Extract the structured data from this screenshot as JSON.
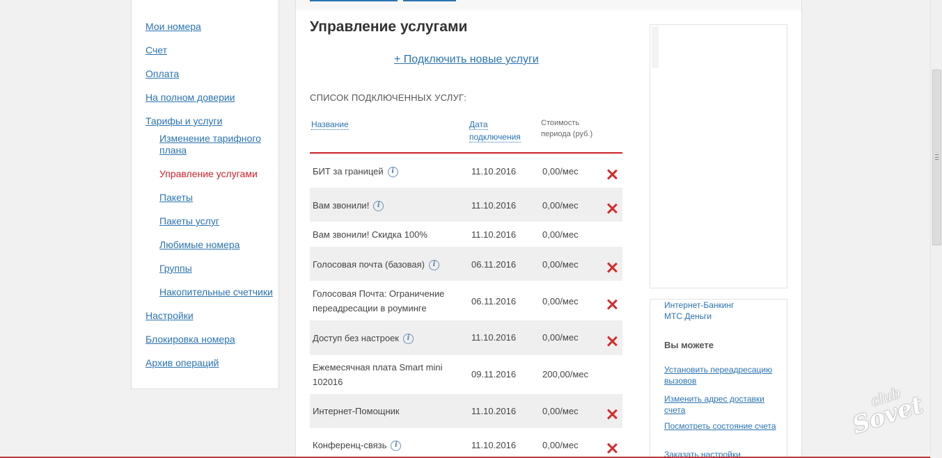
{
  "sidebar": {
    "items": [
      {
        "label": "Мои номера"
      },
      {
        "label": "Счет"
      },
      {
        "label": "Оплата"
      },
      {
        "label": "На полном доверии"
      },
      {
        "label": "Тарифы и услуги"
      },
      {
        "label": "Изменение тарифного плана"
      },
      {
        "label": "Управление услугами"
      },
      {
        "label": "Пакеты"
      },
      {
        "label": "Пакеты услуг"
      },
      {
        "label": "Любимые номера"
      },
      {
        "label": "Группы"
      },
      {
        "label": "Накопительные счетчики"
      },
      {
        "label": "Настройки"
      },
      {
        "label": "Блокировка номера"
      },
      {
        "label": "Архив операций"
      }
    ]
  },
  "main": {
    "title": "Управление услугами",
    "connect_link": "+ Подключить новые услуги",
    "list_title": "СПИСОК ПОДКЛЮЧЕННЫХ УСЛУГ:",
    "headers": {
      "name": "Название",
      "date_line1": "Дата",
      "date_line2": "подключения",
      "cost_line1": "Стоимость",
      "cost_line2": "периода (руб.)"
    },
    "rows": [
      {
        "name": "БИТ за границей",
        "info": true,
        "date": "11.10.2016",
        "cost": "0,00/мес",
        "deletable": true
      },
      {
        "name": "Вам звонили!",
        "info": true,
        "date": "11.10.2016",
        "cost": "0,00/мес",
        "deletable": true
      },
      {
        "name": "Вам звонили! Скидка 100%",
        "info": false,
        "date": "11.10.2016",
        "cost": "0,00/мес",
        "deletable": false
      },
      {
        "name": "Голосовая почта (базовая)",
        "info": true,
        "date": "06.11.2016",
        "cost": "0,00/мес",
        "deletable": true
      },
      {
        "name": "Голосовая Почта: Ограничение переадресации в роуминге",
        "info": false,
        "date": "06.11.2016",
        "cost": "0,00/мес",
        "deletable": true
      },
      {
        "name": "Доступ без настроек",
        "info": true,
        "date": "11.10.2016",
        "cost": "0,00/мес",
        "deletable": true
      },
      {
        "name": "Ежемесячная плата Smart mini 102016",
        "info": false,
        "date": "09.11.2016",
        "cost": "200,00/мес",
        "deletable": false
      },
      {
        "name": "Интернет-Помощник",
        "info": false,
        "date": "11.10.2016",
        "cost": "0,00/мес",
        "deletable": true
      },
      {
        "name": "Конференц-связь",
        "info": true,
        "date": "11.10.2016",
        "cost": "0,00/мес",
        "deletable": true
      }
    ]
  },
  "right": {
    "links_top": [
      "Интернет-Банкинг",
      "МТС Деньги"
    ],
    "heading": "Вы можете",
    "links": [
      "Установить переадресацию вызовов",
      "Изменить адрес доставки счета",
      "Посмотреть состояние счета",
      "Заказать настройки"
    ]
  },
  "watermark": {
    "line1": "club",
    "line2": "Sovet"
  },
  "icons": {
    "info": "info-icon",
    "delete": "delete-x-icon"
  },
  "colors": {
    "link": "#2a73b3",
    "accent_red": "#c8202a",
    "delete": "#d52b2b"
  }
}
